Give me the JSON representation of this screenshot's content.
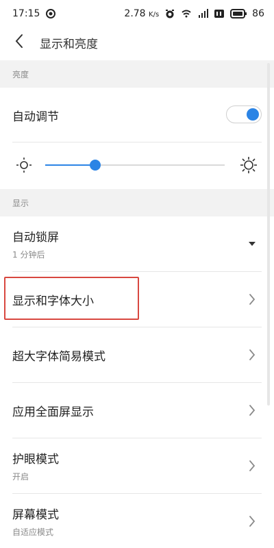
{
  "status_bar": {
    "time": "17:15",
    "speed_value": "2.78",
    "speed_unit": "K/s",
    "battery": "86"
  },
  "header": {
    "title": "显示和亮度"
  },
  "sections": {
    "brightness_label": "亮度",
    "display_label": "显示"
  },
  "brightness": {
    "auto_adjust_label": "自动调节",
    "auto_adjust_on": true,
    "level": 0.28
  },
  "display": {
    "auto_lock": {
      "title": "自动锁屏",
      "subtitle": "1 分钟后"
    },
    "font_size": {
      "title": "显示和字体大小"
    },
    "large_font": {
      "title": "超大字体简易模式"
    },
    "fullscreen": {
      "title": "应用全面屏显示"
    },
    "eye_care": {
      "title": "护眼模式",
      "subtitle": "开启"
    },
    "screen_mode": {
      "title": "屏幕模式",
      "subtitle": "自适应模式"
    }
  },
  "colors": {
    "accent": "#2b84e5",
    "highlight": "#d8473f",
    "section_bg": "#f2f2f2"
  },
  "icons": {
    "back": "chevron-left-icon",
    "dropdown": "caret-down-icon",
    "chevron": "chevron-right-icon",
    "sun_small": "sun-small-icon",
    "sun_large": "sun-large-icon"
  }
}
